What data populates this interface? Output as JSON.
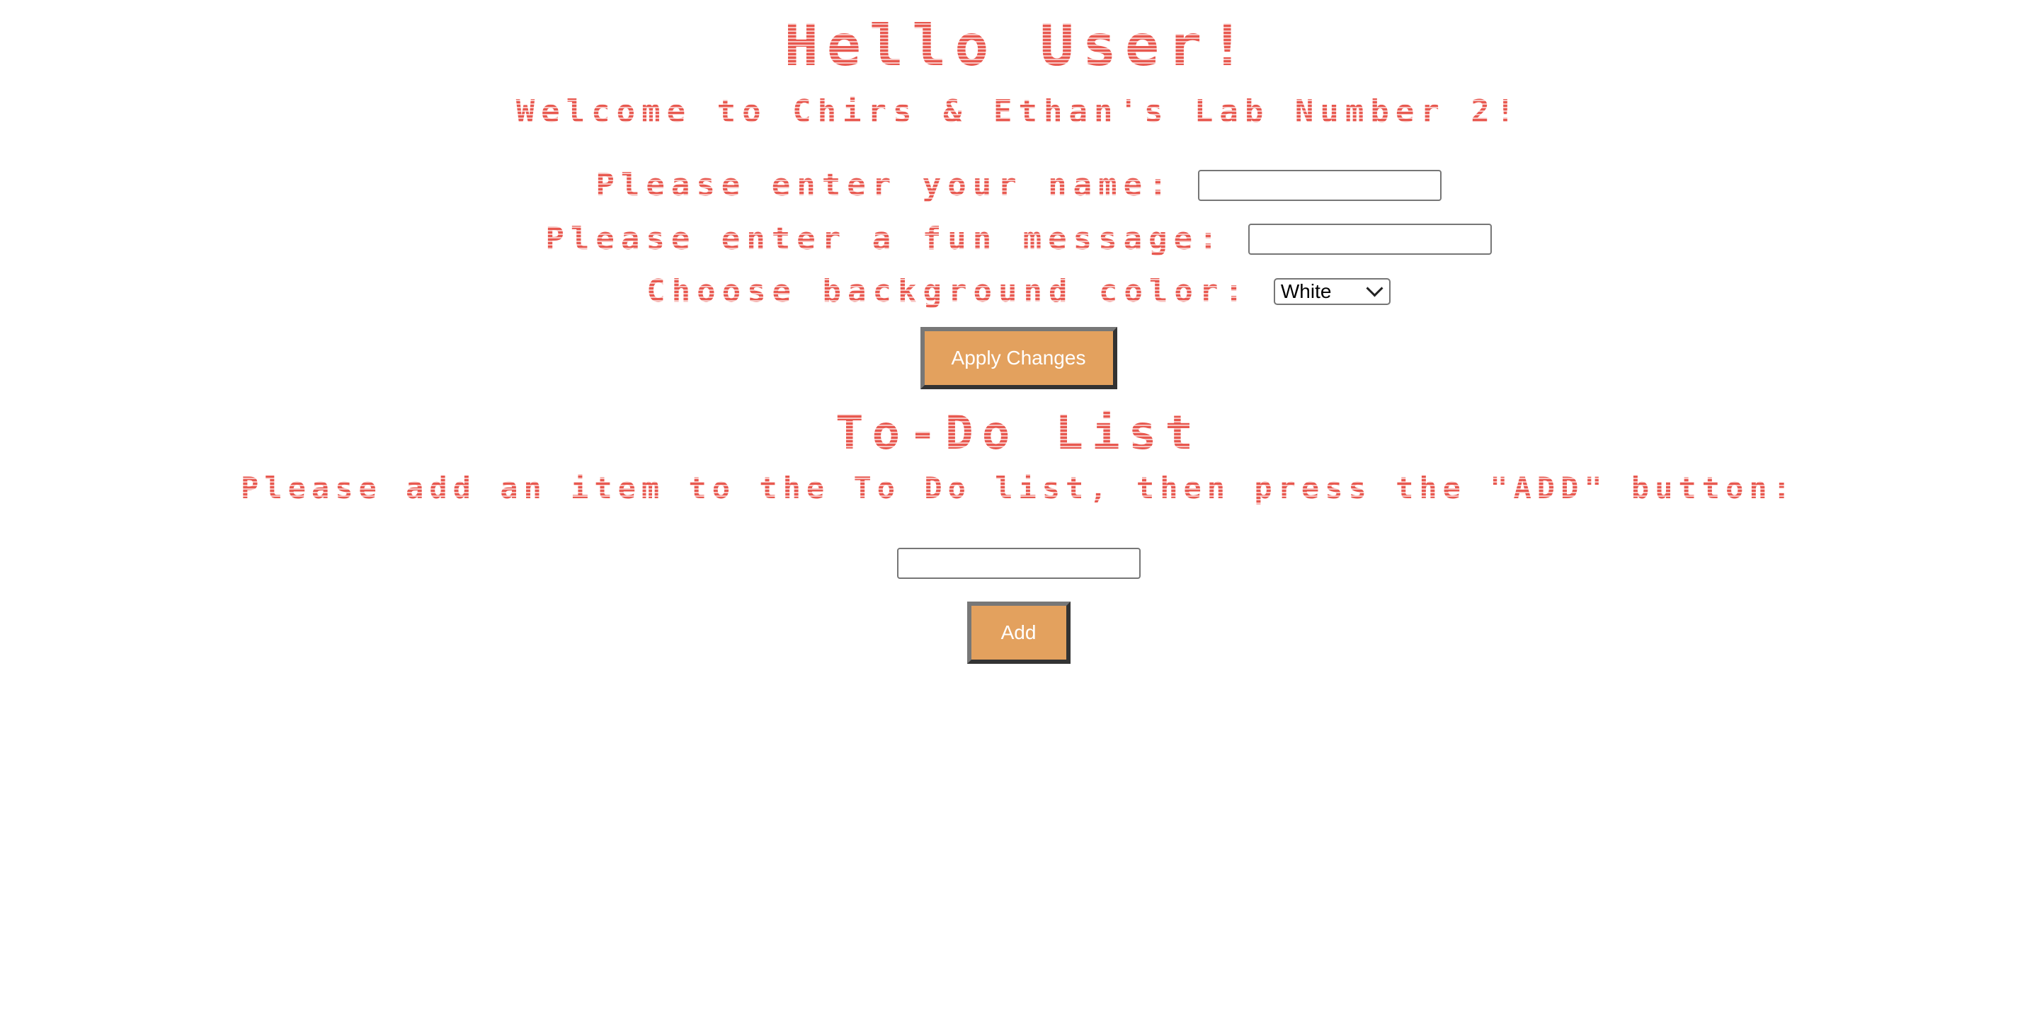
{
  "header": {
    "title": "Hello User!",
    "subtitle": "Welcome to Chirs & Ethan's Lab Number 2!"
  },
  "settings_form": {
    "name_label": "Please enter your name:",
    "name_value": "",
    "message_label": "Please enter a fun message:",
    "message_value": "",
    "color_label": "Choose background color:",
    "color_selected": "White",
    "apply_label": "Apply Changes"
  },
  "todo": {
    "title": "To-Do List",
    "instructions": "Please add an item to the To Do list, then press the \"ADD\" button:",
    "item_value": "",
    "add_label": "Add"
  },
  "colors": {
    "text_accent": "#e05a52",
    "button_fill": "#e3a15e",
    "button_text": "#ffffff",
    "background": "#ffffff"
  }
}
